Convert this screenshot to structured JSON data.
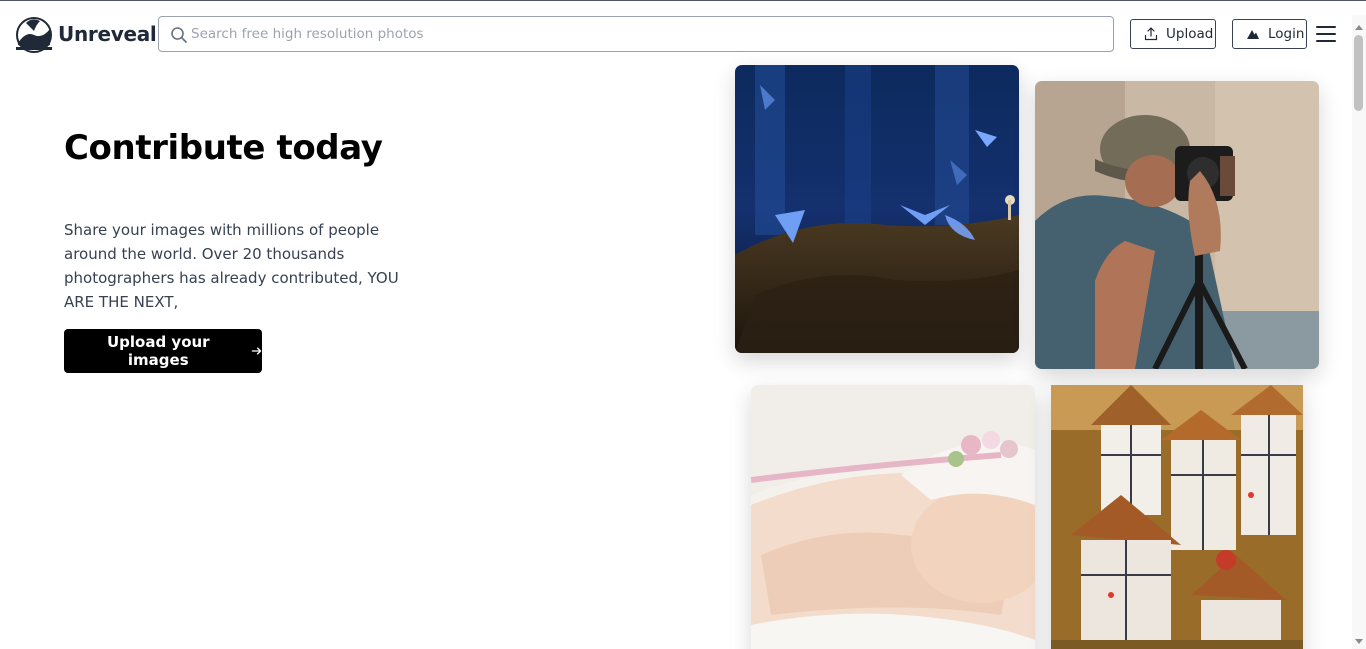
{
  "header": {
    "logo_text": "Unreveal",
    "search_placeholder": "Search free high resolution photos",
    "upload_label": "Upload",
    "login_label": "Login"
  },
  "hero": {
    "title": "Contribute today",
    "description": "Share your images with millions of people around the world. Over 20 thousands photographers has already contributed, YOU ARE THE NEXT,",
    "cta_label": "Upload your images"
  },
  "icons": {
    "search": "search-icon",
    "upload": "upload-icon",
    "login": "user-icon",
    "menu": "hamburger-menu-icon",
    "cta": "arrow-right-icon"
  },
  "colors": {
    "cta_background": "#000000",
    "text_primary": "#111827",
    "border": "#374151"
  }
}
